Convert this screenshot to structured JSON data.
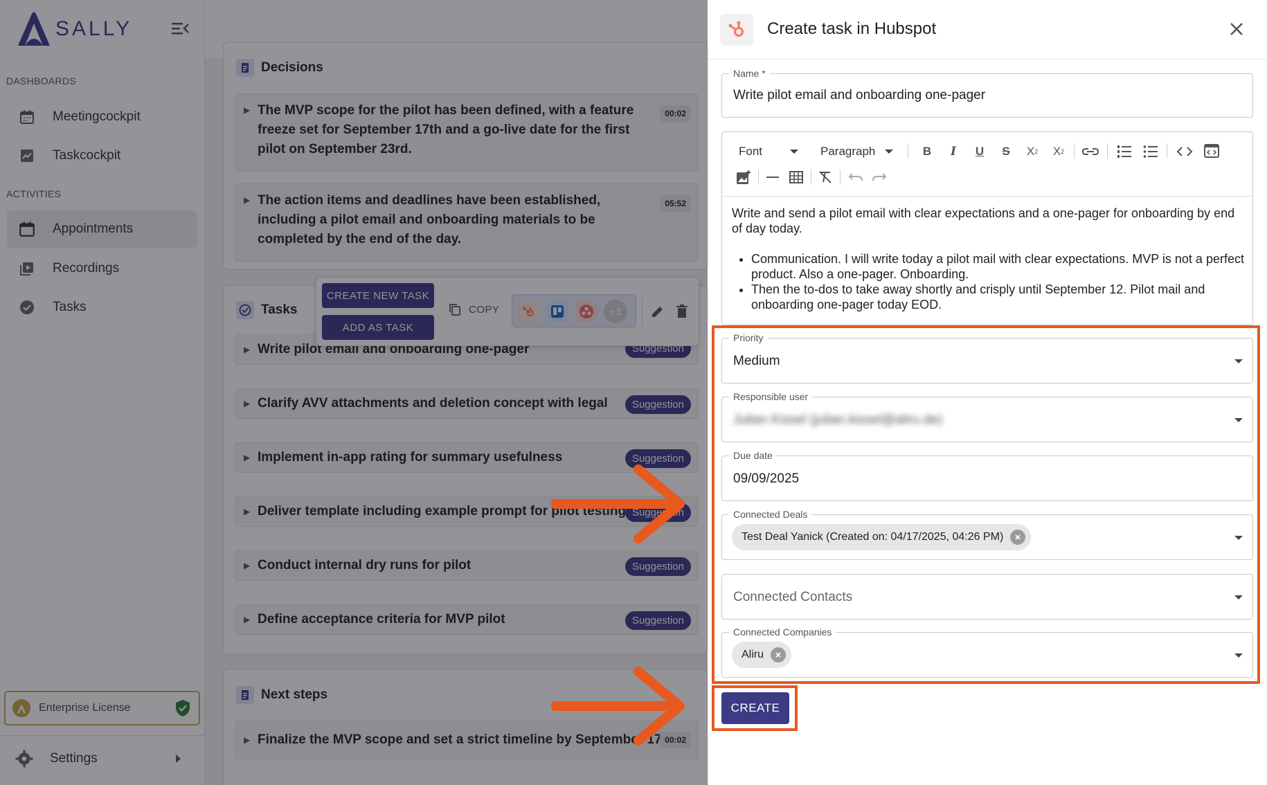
{
  "brand": {
    "name": "SALLY"
  },
  "sidebar": {
    "section_dashboards": "DASHBOARDS",
    "section_activities": "ACTIVITIES",
    "items": [
      {
        "label": "Meetingcockpit",
        "icon": "calendar-icon"
      },
      {
        "label": "Taskcockpit",
        "icon": "chart-icon"
      },
      {
        "label": "Appointments",
        "icon": "calendar-icon",
        "active": true
      },
      {
        "label": "Recordings",
        "icon": "video-library-icon"
      },
      {
        "label": "Tasks",
        "icon": "check-circle-icon"
      }
    ],
    "license": "Enterprise License",
    "settings": "Settings"
  },
  "main": {
    "decisions": {
      "title": "Decisions",
      "rows": [
        {
          "text": "The MVP scope for the pilot has been defined, with a feature freeze set for September 17th and a go-live date for the first pilot on September 23rd.",
          "time": "00:02"
        },
        {
          "text": "The action items and deadlines have been established, including a pilot email and onboarding materials to be completed by the end of the day.",
          "time": "05:52"
        }
      ]
    },
    "tasks": {
      "title": "Tasks",
      "suggestion_label": "Suggestion",
      "rows": [
        "Write pilot email and onboarding one-pager",
        "Clarify AVV attachments and deletion concept with legal",
        "Implement in-app rating for summary usefulness",
        "Deliver template including example prompt for pilot testing",
        "Conduct internal dry runs for pilot",
        "Define acceptance criteria for MVP pilot"
      ]
    },
    "popup": {
      "create_new_task": "CREATE NEW TASK",
      "add_as_task": "ADD AS TASK",
      "copy": "COPY",
      "more_count": "+3"
    },
    "next_steps": {
      "title": "Next steps",
      "rows": [
        {
          "text": "Finalize the MVP scope and set a strict timeline by September 17",
          "time": "00:02"
        }
      ]
    }
  },
  "dialog": {
    "title": "Create task in Hubspot",
    "name": {
      "label": "Name *",
      "value": "Write pilot email and onboarding one-pager"
    },
    "editor": {
      "font_label": "Font",
      "paragraph_label": "Paragraph",
      "body_intro": "Write and send a pilot email with clear expectations and a one-pager for onboarding by end of day today.",
      "bullets": [
        "Communication. I will write today a pilot mail with clear expectations. MVP is not a perfect product. Also a one-pager. Onboarding.",
        "Then the to-dos to take away shortly and crisply until September 12. Pilot mail and onboarding one-pager today EOD."
      ]
    },
    "priority": {
      "label": "Priority",
      "value": "Medium"
    },
    "responsible_user": {
      "label": "Responsible user",
      "value": "Julian Kissel (julian.kissel@aliru.de)"
    },
    "due_date": {
      "label": "Due date",
      "value": "09/09/2025"
    },
    "connected_deals": {
      "label": "Connected Deals",
      "chip": "Test Deal Yanick (Created on: 04/17/2025, 04:26 PM)"
    },
    "connected_contacts": {
      "placeholder": "Connected Contacts"
    },
    "connected_companies": {
      "label": "Connected Companies",
      "chip": "Aliru"
    },
    "create_button": "CREATE"
  },
  "colors": {
    "accent": "#3d3a86",
    "highlight": "#e8591f",
    "hubspot": "#ff7a59"
  }
}
